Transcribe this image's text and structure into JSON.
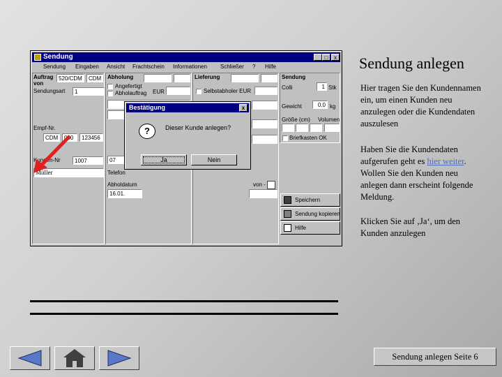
{
  "window": {
    "title": "Sendung",
    "buttons": {
      "minimize": "_",
      "maximize": "□",
      "close": "x"
    },
    "menu": [
      "Sendung",
      "Eingaben",
      "Ansicht",
      "Frachtschein",
      "Informationen",
      "Schließer",
      "Hilfe"
    ],
    "left": {
      "auftrag_label": "Auftrag",
      "von_label": "von",
      "auftrag_value": "520/CDM",
      "auftrag_code": "CDM",
      "sendungsart_label": "Sendungsart",
      "sendungsart_value": "1",
      "empf_label": "Empf-Nr.",
      "empf_values": [
        "CDM",
        "000",
        "123456"
      ],
      "kunden_label": "Kunden-Nr",
      "kunden_value": "1007",
      "name_value": "Müller"
    },
    "abholung": {
      "heading": "Abholung",
      "angefertigt": "Angefertigt",
      "abholauftrag": "Abholauftrag",
      "currency": "EUR",
      "telefon_label": "Telefon",
      "abholdatum_label": "Abholdatum",
      "abholdatum_value": "16.01.",
      "nr_value": "07"
    },
    "lieferung": {
      "heading": "Lieferung",
      "selbstabholer": "Selbstabholer EUR",
      "zeitraum": "von - bis"
    },
    "sendung": {
      "heading": "Sendung",
      "colli_label": "Colli",
      "colli_value": "1",
      "colli_unit": "Stk",
      "gewicht_label": "Gewicht",
      "gewicht_value": "0.0",
      "gewicht_unit": "kg",
      "groesse_label": "Größe (cm)",
      "volumen_label": "Volumen",
      "briefkasten": "Briefkasten OK"
    },
    "actions": {
      "speichern": "Speichern",
      "kopieren": "Sendung kopieren",
      "hilfe": "Hilfe"
    }
  },
  "dialog": {
    "title": "Bestätigung",
    "close": "x",
    "question_icon": "?",
    "message": "Dieser Kunde anlegen?",
    "yes": "Ja",
    "no": "Nein"
  },
  "slide": {
    "title": "Sendung anlegen",
    "para1": "Hier tragen Sie den Kundennamen ein, um einen Kunden neu anzulegen oder die Kundendaten auszulesen",
    "para2_before": "Haben Sie die Kundendaten aufgerufen geht es ",
    "para2_link": "hier weiter",
    "para2_after": ". Wollen Sie den Kunden neu anlegen dann erscheint folgende Meldung.",
    "para3": "Klicken Sie auf ‚Ja‘, um den Kunden anzulegen",
    "page_info": "Sendung anlegen Seite 6"
  },
  "icons": {
    "arrow": "red-arrow-icon",
    "back": "back-triangle-icon",
    "home": "home-icon",
    "forward": "forward-triangle-icon"
  },
  "colors": {
    "titlebar": "#000080",
    "arrow": "#e02020",
    "link": "#4a6fc5"
  }
}
